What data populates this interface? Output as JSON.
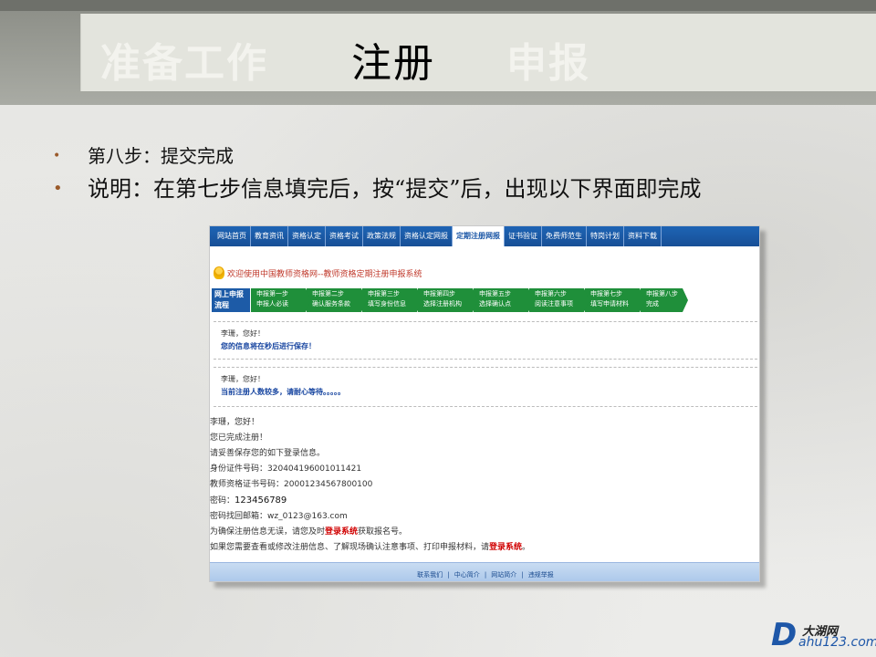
{
  "slide": {
    "title_steps": [
      "准备工作",
      "注册",
      "申报"
    ],
    "active_step": "注册",
    "bullets": [
      "第八步：提交完成",
      "说明：在第七步信息填完后，按“提交”后，出现以下界面即完成"
    ],
    "bullet_marker": "•"
  },
  "screenshot": {
    "nav": [
      "网站首页",
      "教育资讯",
      "资格认定",
      "资格考试",
      "政策法规",
      "资格认定网报",
      "定期注册网报",
      "证书验证",
      "免费师范生",
      "特岗计划",
      "资料下载"
    ],
    "nav_active": "定期注册网报",
    "welcome": "欢迎使用中国教师资格网--教师资格定期注册申报系统",
    "step_label": "网上申报流程",
    "steps": [
      {
        "title": "申报第一步",
        "desc": "申报人必读"
      },
      {
        "title": "申报第二步",
        "desc": "确认服务条款"
      },
      {
        "title": "申报第三步",
        "desc": "填写身份信息"
      },
      {
        "title": "申报第四步",
        "desc": "选择注册机构"
      },
      {
        "title": "申报第五步",
        "desc": "选择确认点"
      },
      {
        "title": "申报第六步",
        "desc": "阅读注意事项"
      },
      {
        "title": "申报第七步",
        "desc": "填写申请材料"
      },
      {
        "title": "申报第八步",
        "desc": "完成"
      }
    ],
    "msg1": {
      "greeting": "李珊，您好！",
      "text": "您的信息将在秒后进行保存！"
    },
    "msg2": {
      "greeting": "李珊，您好！",
      "text": "当前注册人数较多，请耐心等待。。。。。"
    },
    "final": {
      "greeting": "李珊，您好！",
      "done": "您已完成注册！",
      "keep": "请妥善保存您的如下登录信息。",
      "id_label": "身份证件号码：",
      "id_value": "320404196001011421",
      "cert_label": "教师资格证书号码：",
      "cert_value": "20001234567800100",
      "pwd_label": "密码：",
      "pwd_value": "123456789",
      "mail_label": "密码找回邮箱：",
      "mail_value": "wz_0123@163.com",
      "line1_a": "为确保注册信息无误，请您及时",
      "line1_link": "登录系统",
      "line1_b": "获取报名号。",
      "line2_a": "如果您需要查看或修改注册信息、了解现场确认注意事项、打印申报材料，请",
      "line2_link": "登录系统",
      "line2_b": "。"
    },
    "footer": [
      "联系我们",
      "中心简介",
      "网站简介",
      "违规举报"
    ]
  },
  "logo": {
    "letter": "D",
    "name": "大湖网",
    "url": "ahu123.com"
  },
  "colors": {
    "nav": "#1e64b5",
    "step": "#1f8f3a",
    "link_red": "#d00000"
  }
}
